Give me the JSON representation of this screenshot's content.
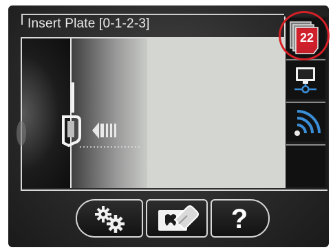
{
  "header": {
    "title": "Insert Plate [0-1-2-3]"
  },
  "sidebar": {
    "items": [
      {
        "name": "plates",
        "icon": "plates-stack-icon",
        "badge": "22"
      },
      {
        "name": "network",
        "icon": "monitor-network-icon"
      },
      {
        "name": "wireless",
        "icon": "wireless-signal-icon"
      },
      {
        "name": "empty",
        "icon": ""
      }
    ]
  },
  "toolbar": {
    "buttons": [
      {
        "name": "settings",
        "icon": "gears-icon"
      },
      {
        "name": "erase",
        "icon": "tooth-eraser-icon"
      },
      {
        "name": "help",
        "label": "?"
      }
    ]
  },
  "colors": {
    "accent_red": "#d61f26",
    "screen_bg": "#2b2b2b",
    "plate_area": "#d3d6d1",
    "network_blue": "#3a8fd8"
  }
}
